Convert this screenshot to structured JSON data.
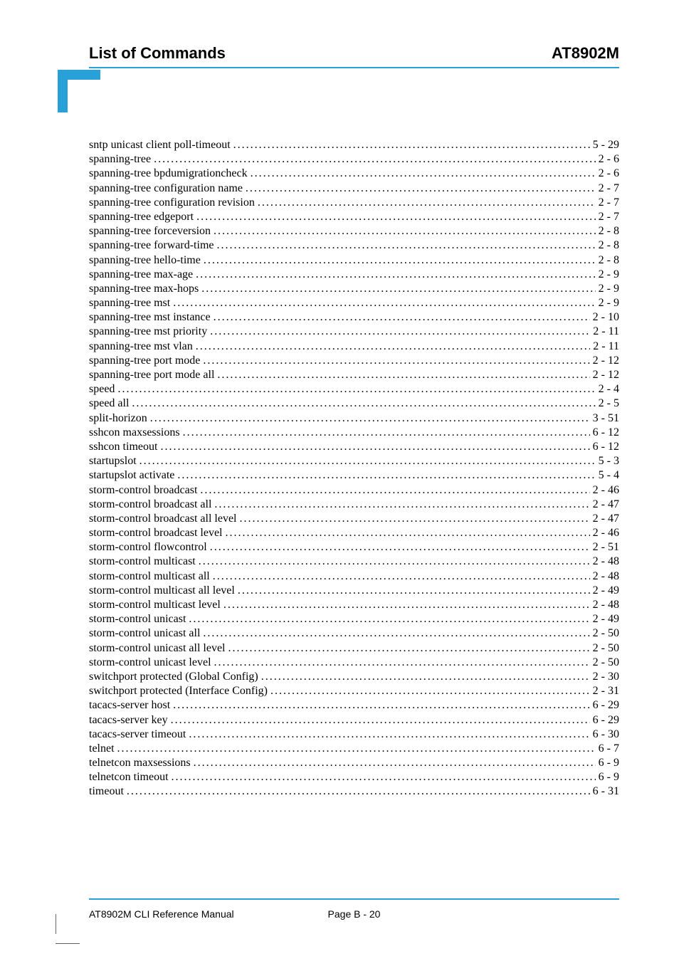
{
  "header": {
    "left": "List of Commands",
    "right": "AT8902M"
  },
  "toc": [
    {
      "label": "sntp unicast client poll-timeout",
      "page": "5 - 29"
    },
    {
      "label": "spanning-tree",
      "page": "2 - 6"
    },
    {
      "label": "spanning-tree bpdumigrationcheck",
      "page": "2 - 6"
    },
    {
      "label": "spanning-tree configuration name",
      "page": "2 - 7"
    },
    {
      "label": "spanning-tree configuration revision",
      "page": "2 - 7"
    },
    {
      "label": "spanning-tree edgeport",
      "page": "2 - 7"
    },
    {
      "label": "spanning-tree forceversion",
      "page": "2 - 8"
    },
    {
      "label": "spanning-tree forward-time",
      "page": "2 - 8"
    },
    {
      "label": "spanning-tree hello-time",
      "page": "2 - 8"
    },
    {
      "label": "spanning-tree max-age",
      "page": "2 - 9"
    },
    {
      "label": "spanning-tree max-hops",
      "page": "2 - 9"
    },
    {
      "label": "spanning-tree mst",
      "page": "2 - 9"
    },
    {
      "label": "spanning-tree mst instance",
      "page": "2 - 10"
    },
    {
      "label": "spanning-tree mst priority",
      "page": "2 - 11"
    },
    {
      "label": "spanning-tree mst vlan",
      "page": "2 - 11"
    },
    {
      "label": "spanning-tree port mode",
      "page": "2 - 12"
    },
    {
      "label": "spanning-tree port mode all",
      "page": "2 - 12"
    },
    {
      "label": "speed",
      "page": "2 - 4"
    },
    {
      "label": "speed all",
      "page": "2 - 5"
    },
    {
      "label": "split-horizon",
      "page": "3 - 51"
    },
    {
      "label": "sshcon maxsessions",
      "page": "6 - 12"
    },
    {
      "label": "sshcon timeout",
      "page": "6 - 12"
    },
    {
      "label": "startupslot",
      "page": "5 - 3"
    },
    {
      "label": "startupslot activate",
      "page": "5 - 4"
    },
    {
      "label": "storm-control broadcast",
      "page": "2 - 46"
    },
    {
      "label": "storm-control broadcast all",
      "page": "2 - 47"
    },
    {
      "label": "storm-control broadcast all level",
      "page": "2 - 47"
    },
    {
      "label": "storm-control broadcast level",
      "page": "2 - 46"
    },
    {
      "label": "storm-control flowcontrol",
      "page": "2 - 51"
    },
    {
      "label": "storm-control multicast",
      "page": "2 - 48"
    },
    {
      "label": "storm-control multicast all",
      "page": "2 - 48"
    },
    {
      "label": "storm-control multicast all level",
      "page": "2 - 49"
    },
    {
      "label": "storm-control multicast level",
      "page": "2 - 48"
    },
    {
      "label": "storm-control unicast",
      "page": "2 - 49"
    },
    {
      "label": "storm-control unicast all",
      "page": "2 - 50"
    },
    {
      "label": "storm-control unicast all level",
      "page": "2 - 50"
    },
    {
      "label": "storm-control unicast level",
      "page": "2 - 50"
    },
    {
      "label": "switchport protected (Global Config)",
      "page": "2 - 30"
    },
    {
      "label": "switchport protected (Interface Config)",
      "page": "2 - 31"
    },
    {
      "label": "tacacs-server host",
      "page": "6 - 29"
    },
    {
      "label": "tacacs-server key",
      "page": "6 - 29"
    },
    {
      "label": "tacacs-server timeout",
      "page": "6 - 30"
    },
    {
      "label": "telnet",
      "page": "6 - 7"
    },
    {
      "label": "telnetcon maxsessions",
      "page": "6 - 9"
    },
    {
      "label": "telnetcon timeout",
      "page": "6 - 9"
    },
    {
      "label": "timeout",
      "page": "6 - 31"
    }
  ],
  "footer": {
    "left": "AT8902M CLI Reference Manual",
    "center": "Page B - 20",
    "right": ""
  }
}
